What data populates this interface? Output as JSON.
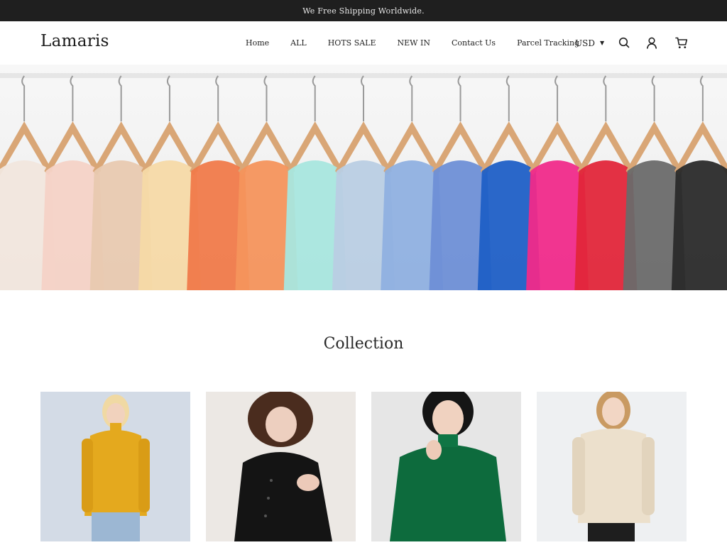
{
  "announcement": "We Free Shipping Worldwide.",
  "brand": "Lamaris",
  "nav": [
    "Home",
    "ALL",
    "HOTS SALE",
    "NEW IN",
    "Contact Us",
    "Parcel Tracking"
  ],
  "currency": "USD",
  "icons": {
    "search": "search-icon",
    "account": "user-icon",
    "cart": "cart-icon",
    "caret": "caret-down-icon"
  },
  "hero": {
    "image": "clothing-rack-banner",
    "colors": [
      "#f1e6dd",
      "#f4d2c6",
      "#e8c9b0",
      "#f5d9a6",
      "#f07a4a",
      "#f4935c",
      "#a8e6de",
      "#b9cde3",
      "#8fb0e0",
      "#6e8fd6",
      "#1f5fc6",
      "#f02a8a",
      "#e1263a",
      "#6a6a6a",
      "#2a2a2a"
    ]
  },
  "collection": {
    "title": "Collection",
    "products": [
      {
        "name": "yellow-turtleneck-sweater",
        "color": "#e4a91e"
      },
      {
        "name": "black-button-cardigan",
        "color": "#141414"
      },
      {
        "name": "green-mock-neck-sweater",
        "color": "#0d6b3d"
      },
      {
        "name": "cream-knit-sweater",
        "color": "#ece0cc"
      }
    ]
  }
}
